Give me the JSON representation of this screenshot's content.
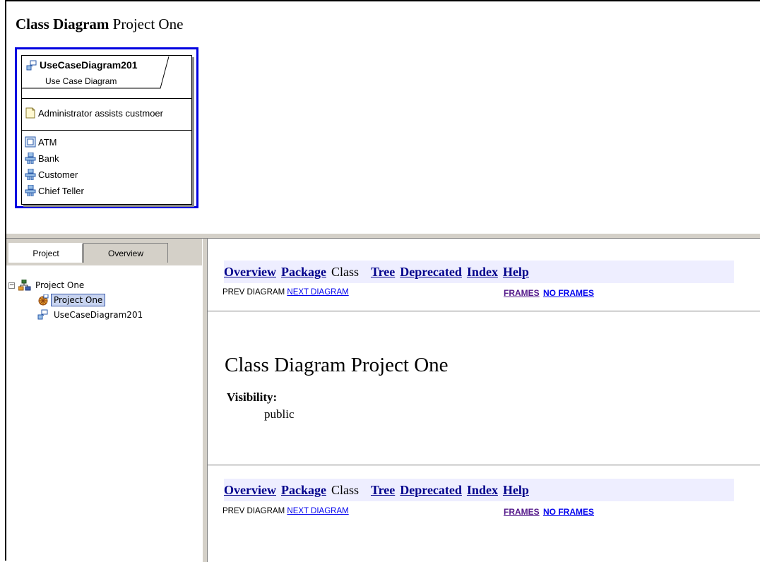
{
  "header": {
    "title_bold": "Class Diagram",
    "title_rest": "Project One"
  },
  "diagram": {
    "package_name": "UseCaseDiagram201",
    "package_subtitle": "Use Case Diagram",
    "note": "Administrator assists custmoer",
    "elements": [
      {
        "label": "ATM",
        "icon": "class-icon"
      },
      {
        "label": "Bank",
        "icon": "actor-icon"
      },
      {
        "label": "Customer",
        "icon": "actor-icon"
      },
      {
        "label": "Chief Teller",
        "icon": "actor-icon"
      }
    ]
  },
  "left_panel": {
    "tabs": [
      "Project",
      "Overview"
    ],
    "tree": {
      "root": "Project One",
      "children": [
        "Project One",
        "UseCaseDiagram201"
      ]
    }
  },
  "doc": {
    "nav": {
      "overview": "Overview",
      "package": "Package",
      "class": "Class",
      "tree": "Tree",
      "deprecated": "Deprecated",
      "index": "Index",
      "help": "Help"
    },
    "prev": "PREV DIAGRAM",
    "next": "NEXT DIAGRAM",
    "frames": "FRAMES",
    "no_frames": "NO FRAMES",
    "title": "Class Diagram Project One",
    "visibility_label": "Visibility:",
    "visibility_value": "public"
  },
  "colors": {
    "selection_border": "#0000e0",
    "navbar_bg": "#eeeeff",
    "nav_link": "#00008b"
  }
}
